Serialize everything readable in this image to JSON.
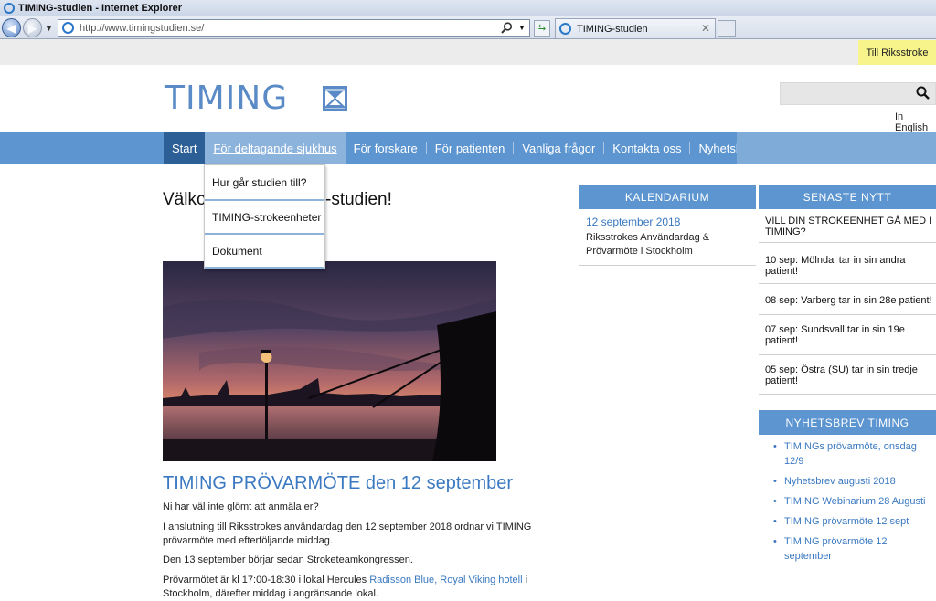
{
  "browser": {
    "window_title": "TIMING-studien - Internet Explorer",
    "url": "http://www.timingstudien.se/",
    "tab_title": "TIMING-studien"
  },
  "top_link": "Till Riksstroke",
  "header": {
    "logo": "TIMING",
    "english_link": "In English"
  },
  "nav": {
    "items": [
      "Start",
      "För deltagande sjukhus",
      "För forskare",
      "För patienten",
      "Vanliga frågor",
      "Kontakta oss",
      "Nyhetsbrev"
    ]
  },
  "dropdown": {
    "items": [
      "Hur går studien till?",
      "TIMING-strokeenheter",
      "Dokument"
    ]
  },
  "main": {
    "welcome_left": "Välko",
    "welcome_right": "-studien!",
    "article_title": "TIMING PRÖVARMÖTE den 12 september",
    "p1": "Ni har väl inte glömt att anmäla er?",
    "p2": "I anslutning till Riksstrokes användardag den 12 september 2018 ordnar vi TIMING prövarmöte med efterföljande middag.",
    "p3": "Den 13 september börjar sedan Stroketeamkongressen.",
    "p4_before": "Prövarmötet är kl 17:00-18:30 i lokal Hercules ",
    "p4_link": "Radisson Blue, Royal Viking hotell",
    "p4_after": " i Stockholm, därefter middag i angränsande lokal."
  },
  "calendar": {
    "heading": "KALENDARIUM",
    "date": "12 september 2018",
    "text": "Riksstrokes Användardag & Prövarmöte i Stockholm"
  },
  "news": {
    "heading": "SENASTE NYTT",
    "items": [
      "VILL DIN STROKEENHET GÅ MED I TIMING?",
      "10 sep: Mölndal tar in sin andra patient!",
      "08 sep: Varberg tar in sin 28e patient!",
      "07 sep: Sundsvall tar in sin 19e patient!",
      "05 sep: Östra (SU) tar in sin tredje patient!"
    ]
  },
  "newsletter": {
    "heading": "NYHETSBREV TIMING",
    "items": [
      "TIMINGs prövarmöte, onsdag 12/9",
      "Nyhetsbrev augusti 2018",
      "TIMING Webinarium 28 Augusti",
      "TIMING prövarmöte 12 sept",
      "TIMING prövarmöte 12 september"
    ]
  },
  "colors": {
    "brand_blue": "#5c95d0",
    "nav_active": "#2b5f96",
    "link_blue": "#3a79c1",
    "highlight_yellow": "#f6f48a"
  }
}
